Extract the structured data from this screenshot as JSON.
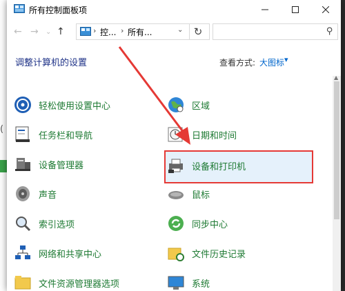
{
  "window": {
    "title": "所有控制面板项",
    "minimize_icon": "minimize-icon",
    "maximize_icon": "maximize-icon",
    "close_icon": "close-icon"
  },
  "nav": {
    "back_icon": "back-arrow-icon",
    "forward_icon": "forward-arrow-icon",
    "recent_icon": "chevron-down-icon",
    "up_icon": "up-arrow-icon",
    "address_segments": [
      "控...",
      "所有..."
    ],
    "refresh_icon": "refresh-icon",
    "search_placeholder": "",
    "search_icon": "search-icon"
  },
  "content": {
    "heading": "调整计算机的设置",
    "view_by_label": "查看方式:",
    "view_by_value": "大图标"
  },
  "items_left": [
    {
      "label": "轻松使用设置中心",
      "icon": "ease-of-access-icon"
    },
    {
      "label": "任务栏和导航",
      "icon": "taskbar-icon"
    },
    {
      "label": "设备管理器",
      "icon": "device-manager-icon"
    },
    {
      "label": "声音",
      "icon": "speaker-icon"
    },
    {
      "label": "索引选项",
      "icon": "indexing-icon"
    },
    {
      "label": "网络和共享中心",
      "icon": "network-icon"
    },
    {
      "label": "文件资源管理器选项",
      "icon": "folder-options-icon"
    }
  ],
  "items_right": [
    {
      "label": "区域",
      "icon": "region-icon"
    },
    {
      "label": "日期和时间",
      "icon": "clock-icon"
    },
    {
      "label": "设备和打印机",
      "icon": "printer-icon"
    },
    {
      "label": "鼠标",
      "icon": "mouse-icon"
    },
    {
      "label": "同步中心",
      "icon": "sync-icon"
    },
    {
      "label": "文件历史记录",
      "icon": "file-history-icon"
    },
    {
      "label": "系统",
      "icon": "system-icon"
    }
  ],
  "colors": {
    "link_green": "#1e7a33",
    "heading_blue": "#1e3287",
    "highlight_red": "#e53935",
    "selected_bg": "#e5f1fb"
  }
}
